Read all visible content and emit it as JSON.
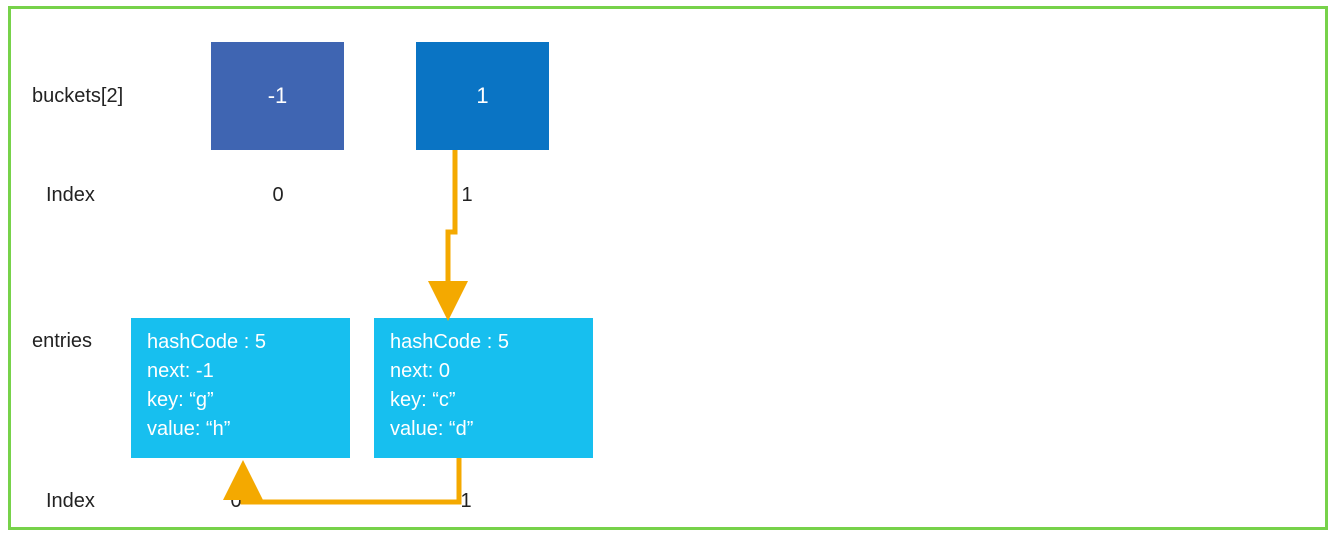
{
  "labels": {
    "buckets": "buckets[2]",
    "index_top": "Index",
    "entries": "entries",
    "index_bottom": "Index"
  },
  "buckets": [
    {
      "value": "-1",
      "index": "0"
    },
    {
      "value": "1",
      "index": "1"
    }
  ],
  "entries": [
    {
      "hashCode": "hashCode : 5",
      "next": "next: -1",
      "key": "key: “g”",
      "value": "value: “h”",
      "index": "0"
    },
    {
      "hashCode": "hashCode : 5",
      "next": "next: 0",
      "key": "key: “c”",
      "value": "value: “d”",
      "index": "1"
    }
  ],
  "chart_data": {
    "type": "diagram",
    "description": "Hash table / dictionary internal layout showing buckets array pointing into entries array with collision chain",
    "buckets_label": "buckets[2]",
    "buckets": [
      {
        "index": 0,
        "value": -1
      },
      {
        "index": 1,
        "value": 1
      }
    ],
    "entries_label": "entries",
    "entries": [
      {
        "index": 0,
        "hashCode": 5,
        "next": -1,
        "key": "g",
        "value": "h"
      },
      {
        "index": 1,
        "hashCode": 5,
        "next": 0,
        "key": "c",
        "value": "d"
      }
    ],
    "arrows": [
      {
        "from": "buckets[1]",
        "to": "entries[1]"
      },
      {
        "from": "entries[1].next",
        "to": "entries[0]"
      }
    ]
  }
}
